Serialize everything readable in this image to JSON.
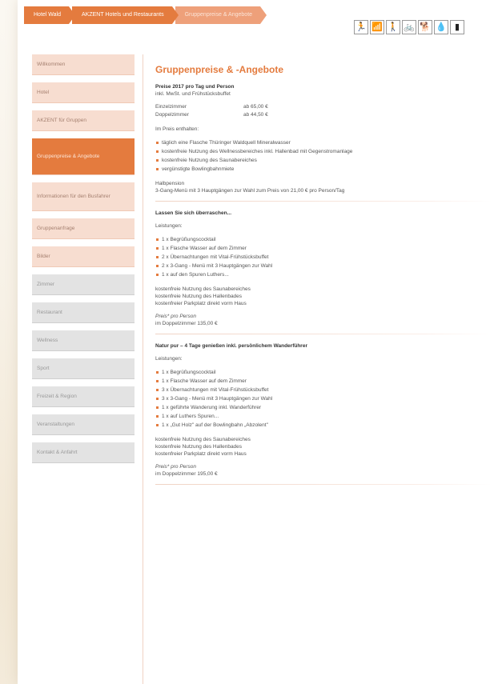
{
  "breadcrumb": [
    "Hotel Wald",
    "AKZENT Hotels und Restaurants",
    "Gruppenpreise & Angebote"
  ],
  "header_icons": [
    {
      "name": "running-icon",
      "glyph": "🏃"
    },
    {
      "name": "wifi-icon",
      "glyph": "📶"
    },
    {
      "name": "hiking-icon",
      "glyph": "🚶"
    },
    {
      "name": "bicycle-icon",
      "glyph": "🚲"
    },
    {
      "name": "dog-icon",
      "glyph": "🐕"
    },
    {
      "name": "water-drop-icon",
      "glyph": "💧"
    },
    {
      "name": "extra-icon",
      "glyph": "▮"
    }
  ],
  "sidebar": {
    "items": [
      {
        "label": "Willkommen",
        "style": "light"
      },
      {
        "label": "Hotel",
        "style": "light"
      },
      {
        "label": "AKZENT für Gruppen",
        "style": "light"
      },
      {
        "label": "Gruppenpreise & Angebote",
        "style": "active"
      },
      {
        "label": "Informationen für den Busfahrer",
        "style": "tall"
      },
      {
        "label": "Gruppenanfrage",
        "style": "light"
      },
      {
        "label": "Bilder",
        "style": "light"
      },
      {
        "label": "Zimmer",
        "style": "grey"
      },
      {
        "label": "Restaurant",
        "style": "grey"
      },
      {
        "label": "Wellness",
        "style": "grey"
      },
      {
        "label": "Sport",
        "style": "grey"
      },
      {
        "label": "Freizeit & Region",
        "style": "grey"
      },
      {
        "label": "Veranstaltungen",
        "style": "grey"
      },
      {
        "label": "Kontakt & Anfahrt",
        "style": "grey"
      }
    ]
  },
  "main": {
    "title": "Gruppenpreise & -Angebote",
    "prices_heading": "Preise 2017 pro Tag und Person",
    "prices_sub": "inkl. MwSt. und Frühstücksbuffet",
    "prices": [
      {
        "label": "Einzelzimmer",
        "value": "ab 65,00 €"
      },
      {
        "label": "Doppelzimmer",
        "value": "ab 44,50 €"
      }
    ],
    "included_label": "Im Preis enthalten:",
    "included": [
      "täglich eine Flasche Thüringer Waldquell Mineralwasser",
      "kostenfreie Nutzung des Wellnessbereiches inkl. Hallenbad mit Gegenstromanlage",
      "kostenfreie Nutzung des Saunabereiches",
      "vergünstigte Bowlingbahnmiete"
    ],
    "halfboard_label": "Halbpension",
    "halfboard_text": "3-Gang-Menü mit 3 Hauptgängen zur Wahl zum Preis von 21,00 € pro Person/Tag",
    "offers": [
      {
        "title": "Lassen Sie sich überraschen...",
        "services_label": "Leistungen:",
        "services": [
          "1 x Begrüßungscocktail",
          "1 x Flasche Wasser auf dem Zimmer",
          "2 x Übernachtungen mit Vital-Frühstücksbuffet",
          "2 x 3-Gang - Menü mit 3 Hauptgängen zur Wahl",
          "1 x auf den Spuren Luthers..."
        ],
        "extras": [
          "kostenfreie Nutzung des Saunabereiches",
          "kostenfreie Nutzung des Hallenbades",
          "kostenfreier Parkplatz direkt vorm Haus"
        ],
        "price_label": "Preis* pro Person",
        "price_value": "im Doppelzimmer 135,00 €"
      },
      {
        "title": "Natur pur – 4 Tage genießen inkl. persönlichem Wanderführer",
        "services_label": "Leistungen:",
        "services": [
          "1 x Begrüßungscocktail",
          "1 x Flasche Wasser auf dem Zimmer",
          "3 x Übernachtungen mit Vital-Frühstücksbuffet",
          "3 x 3-Gang - Menü mit 3 Hauptgängen zur Wahl",
          "1 x geführte Wanderung inkl. Wanderführer",
          "1 x auf Luthers Spuren...",
          "1 x „Gut Holz\" auf der Bowlingbahn „Abzolent\""
        ],
        "extras": [
          "kostenfreie Nutzung des Saunabereiches",
          "kostenfreie Nutzung des Hallenbades",
          "kostenfreier Parkplatz direkt vorm Haus"
        ],
        "price_label": "Preis* pro Person",
        "price_value": "im Doppelzimmer 195,00 €"
      }
    ]
  },
  "colors": {
    "accent": "#e47b3e",
    "nav_light": "#f7ddd0",
    "nav_grey": "#e3e3e3"
  }
}
